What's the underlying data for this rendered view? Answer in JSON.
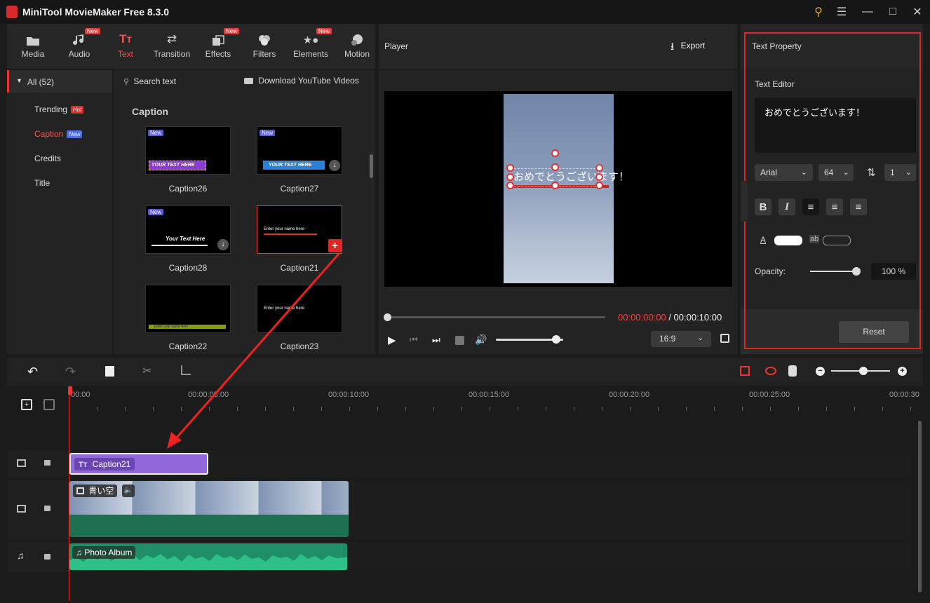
{
  "app": {
    "title": "MiniTool MovieMaker Free 8.3.0"
  },
  "toolbar": {
    "new_badge": "New",
    "items": [
      {
        "label": "Media",
        "icon": "folder-icon"
      },
      {
        "label": "Audio",
        "icon": "music-note-icon",
        "new": true
      },
      {
        "label": "Text",
        "icon": "text-icon",
        "active": true
      },
      {
        "label": "Transition",
        "icon": "transition-icon"
      },
      {
        "label": "Effects",
        "icon": "effects-icon",
        "new": true
      },
      {
        "label": "Filters",
        "icon": "filters-icon"
      },
      {
        "label": "Elements",
        "icon": "elements-icon",
        "new": true
      },
      {
        "label": "Motion",
        "icon": "motion-icon"
      }
    ]
  },
  "categories": {
    "all_label": "All (52)",
    "items": [
      {
        "label": "Trending",
        "badge": "Hot"
      },
      {
        "label": "Caption",
        "badge": "New",
        "active": true
      },
      {
        "label": "Credits"
      },
      {
        "label": "Title"
      }
    ]
  },
  "gallery": {
    "search_label": "Search text",
    "download_label": "Download YouTube Videos",
    "section_title": "Caption",
    "thumb_new": "New",
    "thumbs": [
      {
        "label": "Caption26",
        "text": "YOUR TEXT HERE",
        "new": true
      },
      {
        "label": "Caption27",
        "text": "YOUR TEXT HERE",
        "new": true
      },
      {
        "label": "Caption28",
        "text": "Your Text Here",
        "new": true
      },
      {
        "label": "Caption21",
        "text": "Enter your name here",
        "selected": true
      },
      {
        "label": "Caption22",
        "text": "Enter your name here"
      },
      {
        "label": "Caption23",
        "text": "Enter your name here"
      }
    ]
  },
  "player": {
    "label": "Player",
    "export_label": "Export",
    "overlay_text": "おめでとうございます！",
    "time_current": "00:00:00:00",
    "time_separator": " / ",
    "time_total": "00:00:10:00",
    "aspect": "16:9",
    "progress": 0,
    "volume": 0.9
  },
  "text_property": {
    "title": "Text Property",
    "editor_label": "Text Editor",
    "editor_value": "おめでとうございます！",
    "font": "Arial",
    "size": "64",
    "spacing": "1",
    "opacity_label": "Opacity:",
    "opacity_value": "100 %",
    "opacity_level": 1.0,
    "bold": "B",
    "italic": "I",
    "bg_label": "ab",
    "color_label": "A",
    "reset_label": "Reset",
    "text_color": "#ffffff",
    "accent": "#e02525"
  },
  "timeline": {
    "ruler": [
      "00:00",
      "00:00:05:00",
      "00:00:10:00",
      "00:00:15:00",
      "00:00:20:00",
      "00:00:25:00",
      "00:00:30"
    ],
    "text_clip": "Caption21",
    "video_clip": "青い空",
    "audio_clip": "Photo Album",
    "zoom": 0.55
  }
}
